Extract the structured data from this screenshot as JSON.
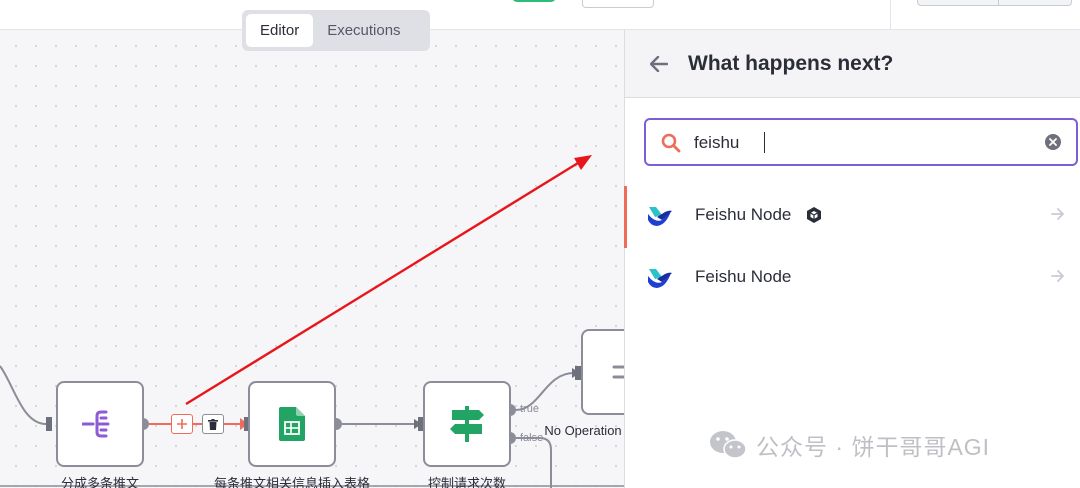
{
  "tabs": [
    {
      "label": "Editor",
      "active": true
    },
    {
      "label": "Executions",
      "active": false
    }
  ],
  "canvas": {
    "nodes": [
      {
        "label": "分成多条推文",
        "icon": "split-out-icon"
      },
      {
        "label": "每条推文相关信息插入表格",
        "icon": "google-sheets-icon"
      },
      {
        "label": "控制请求次数",
        "icon": "if-signpost-icon"
      },
      {
        "label": "No Operation",
        "icon": "no-operation-icon"
      }
    ],
    "port_true": "true",
    "port_false": "false"
  },
  "panel": {
    "title": "What happens next?",
    "search_value": "feishu",
    "results": [
      {
        "name": "Feishu Node",
        "community_badge": true
      },
      {
        "name": "Feishu Node",
        "community_badge": false
      }
    ]
  },
  "watermark": "公众号 · 饼干哥哥AGI",
  "colors": {
    "accent_purple": "#7d5ed6",
    "selection_red": "#ef6b5a",
    "annotation_red": "#e8161c",
    "sheets_green": "#21a464",
    "node_border": "#8b8d98"
  }
}
